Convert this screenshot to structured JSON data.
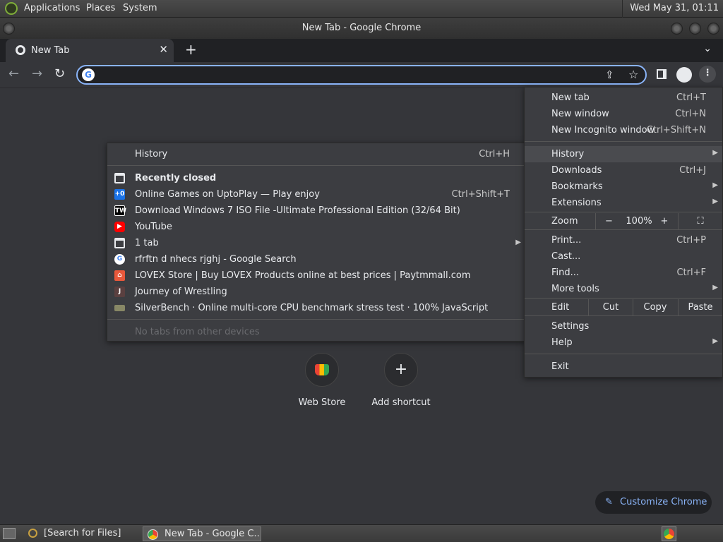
{
  "system_panel": {
    "menus": [
      "Applications",
      "Places",
      "System"
    ],
    "clock": "Wed May 31, 01:11"
  },
  "window": {
    "title": "New Tab - Google Chrome"
  },
  "tab": {
    "label": "New Tab"
  },
  "toolbar": {
    "omnibox_value": ""
  },
  "new_tab_page": {
    "shortcuts": [
      {
        "name": "Web Store",
        "icon": "web-store-icon"
      },
      {
        "name": "Add shortcut",
        "icon": "plus-icon"
      }
    ],
    "customize_label": "Customize Chrome"
  },
  "history_menu": {
    "title": "History",
    "title_shortcut": "Ctrl+H",
    "recently_closed_label": "Recently closed",
    "items": [
      {
        "label": "Online Games on UptoPlay — Play  enjoy",
        "shortcut": "Ctrl+Shift+T",
        "icon": "uptoplay-icon",
        "color": "#1a73e8"
      },
      {
        "label": "Download Windows 7 ISO File -Ultimate  Professional Edition (32/64 Bit)",
        "shortcut": "",
        "icon": "tw-icon",
        "color": "#000000"
      },
      {
        "label": "YouTube",
        "shortcut": "",
        "icon": "youtube-icon",
        "color": "#ff0000"
      },
      {
        "label": "1 tab",
        "shortcut": "",
        "icon": "window-icon",
        "color": "#3c3d41"
      },
      {
        "label": "rfrftn d nhecs rjghj - Google Search",
        "shortcut": "",
        "icon": "google-icon",
        "color": "#ffffff"
      },
      {
        "label": "LOVEX Store | Buy LOVEX Products online at best prices | Paytmmall.com",
        "shortcut": "",
        "icon": "paytm-mall-icon",
        "color": "#e8583b"
      },
      {
        "label": "Journey of Wrestling",
        "shortcut": "",
        "icon": "j-letter-icon",
        "color": "#5a4040"
      },
      {
        "label": "SilverBench · Online multi-core CPU benchmark  stress test · 100% JavaScript",
        "shortcut": "",
        "icon": "silverbench-icon",
        "color": "#888866"
      }
    ],
    "no_tabs_label": "No tabs from other devices"
  },
  "main_menu": {
    "new_tab": {
      "label": "New tab",
      "shortcut": "Ctrl+T"
    },
    "new_window": {
      "label": "New window",
      "shortcut": "Ctrl+N"
    },
    "new_incognito": {
      "label": "New Incognito window",
      "shortcut": "Ctrl+Shift+N"
    },
    "history": {
      "label": "History"
    },
    "downloads": {
      "label": "Downloads",
      "shortcut": "Ctrl+J"
    },
    "bookmarks": {
      "label": "Bookmarks"
    },
    "extensions": {
      "label": "Extensions"
    },
    "zoom": {
      "label": "Zoom",
      "minus": "−",
      "value": "100%",
      "plus": "+"
    },
    "print": {
      "label": "Print...",
      "shortcut": "Ctrl+P"
    },
    "cast": {
      "label": "Cast..."
    },
    "find": {
      "label": "Find...",
      "shortcut": "Ctrl+F"
    },
    "more_tools": {
      "label": "More tools"
    },
    "edit": {
      "label": "Edit",
      "cut": "Cut",
      "copy": "Copy",
      "paste": "Paste"
    },
    "settings": {
      "label": "Settings"
    },
    "help": {
      "label": "Help"
    },
    "exit": {
      "label": "Exit"
    }
  },
  "bottom_panel": {
    "search_task": "[Search for Files]",
    "chrome_task": "New Tab - Google C..."
  }
}
